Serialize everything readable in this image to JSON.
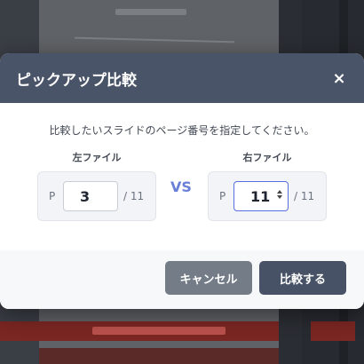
{
  "dialog": {
    "title": "ピックアップ比較",
    "close_label": "×",
    "instruction": "比較したいスライドのページ番号を指定してください。",
    "left": {
      "label": "左ファイル",
      "prefix": "P",
      "page": "3",
      "total": "/ 11"
    },
    "vs_label": "VS",
    "right": {
      "label": "右ファイル",
      "prefix": "P",
      "page": "11",
      "total": "/ 11"
    },
    "cancel_label": "キャンセル",
    "compare_label": "比較する"
  },
  "colors": {
    "header": "#4a5468",
    "vs": "#6a7fd8",
    "cancel_button": "#737c87",
    "compare_button": "#485266",
    "focus_border": "#5a6ee0"
  }
}
